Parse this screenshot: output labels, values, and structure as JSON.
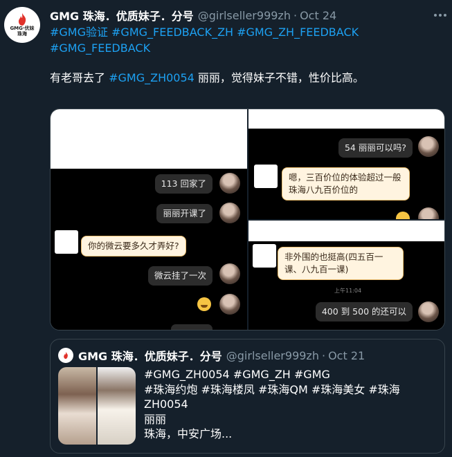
{
  "tweet": {
    "author_name": "GMG 珠海．优质妹子．分号",
    "handle": "@girlseller999zh",
    "separator": "·",
    "date": "Oct 24",
    "avatar_logo_text": [
      "GMG·优妹",
      "珠海"
    ],
    "hashtags": [
      "#GMG验证",
      "#GMG_FEEDBACK_ZH",
      "#GMG_ZH_FEEDBACK",
      "#GMG_FEEDBACK"
    ],
    "text_before": "有老哥去了 ",
    "text_link": "#GMG_ZH0054",
    "text_after": " 丽丽，觉得妹子不错，性价比高。"
  },
  "media": {
    "left_panel": {
      "messages": [
        "113 回家了",
        "丽丽开课了",
        "你的微云要多久才弄好?",
        "微云挂了一次"
      ]
    },
    "top_right_panel": {
      "messages": [
        "54 丽丽可以吗?",
        "嗯，三百价位的体验超过一般珠海八九百价位的"
      ]
    },
    "bottom_right_panel": {
      "messages": [
        "非外围的也挺高(四五百一课、八九百一课)",
        "400 到 500 的还可以"
      ],
      "timestamp": "上午11:04"
    }
  },
  "quote": {
    "author_name": "GMG 珠海．优质妹子．分号",
    "handle": "@girlseller999zh",
    "separator": "·",
    "date": "Oct 21",
    "lines": [
      "#GMG_ZH0054 #GMG_ZH #GMG",
      "#珠海约炮 #珠海楼凤 #珠海QM #珠海美女 #珠海",
      "ZH0054",
      "丽丽",
      "珠海，中安广场..."
    ]
  },
  "colors": {
    "background": "#15202b",
    "link": "#1da1f2",
    "secondary_text": "#8899a6",
    "border": "#38444d"
  }
}
